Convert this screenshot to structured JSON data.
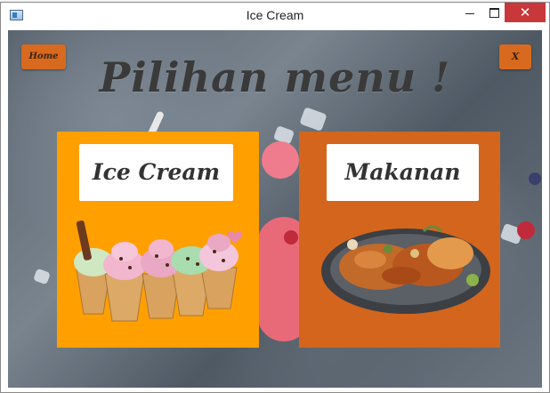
{
  "window": {
    "title": "Ice Cream",
    "minimize_glyph": "",
    "maximize_glyph": "",
    "close_glyph": "✕"
  },
  "toolbar": {
    "home_label": "Home",
    "exit_label": "X"
  },
  "main": {
    "heading": "Pilihan menu !",
    "cards": [
      {
        "label": "Ice Cream",
        "image": "ice-cream-cones-icon"
      },
      {
        "label": "Makanan",
        "image": "seafood-platter-icon"
      }
    ]
  },
  "colors": {
    "accent_orange": "#d86a1f",
    "ice_card": "#ffa000",
    "food_card": "#d4651d",
    "close_red": "#c8373a"
  }
}
